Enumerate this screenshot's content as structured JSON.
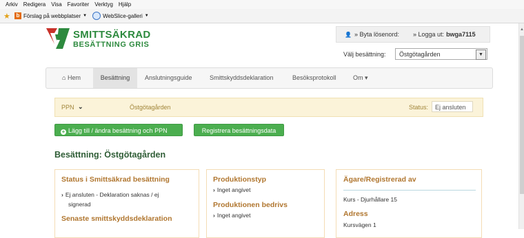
{
  "browser": {
    "menu": [
      "Arkiv",
      "Redigera",
      "Visa",
      "Favoriter",
      "Verktyg",
      "Hjälp"
    ],
    "favorites": [
      {
        "label": "Förslag på webbplatser",
        "icon": "bing-icon"
      },
      {
        "label": "WebSlice-galleri",
        "icon": "ie-icon"
      }
    ]
  },
  "logo": {
    "line1": "SMITTSÄKRAD",
    "line2": "BESÄTTNING GRIS"
  },
  "user": {
    "change_password": "» Byta lösenord:",
    "logout": "» Logga ut:",
    "username": "bwga7115"
  },
  "choose": {
    "label": "Välj besättning:",
    "selected": "Östgötagården"
  },
  "nav": {
    "home": "Hem",
    "items": [
      "Besättning",
      "Anslutningsguide",
      "Smittskyddsdeklaration",
      "Besöksprotokoll",
      "Om ▾"
    ],
    "active": "Besättning"
  },
  "ppn": {
    "label": "PPN",
    "name": "Östgötagården",
    "status_label": "Status:",
    "status": "Ej ansluten"
  },
  "buttons": {
    "add": "Lägg till / ändra besättning och PPN",
    "register": "Registrera besättningsdata"
  },
  "page_title": "Besättning: Östgötagården",
  "panel1": {
    "heading": "Status i Smittsäkrad besättning",
    "status_line1": "Ej ansluten - Deklaration saknas / ej",
    "status_line2": "signerad",
    "heading2": "Senaste smittskyddsdeklaration"
  },
  "panel2": {
    "heading1": "Produktionstyp",
    "value1": "Inget angivet",
    "heading2": "Produktionen bedrivs",
    "value2": "Inget angivet"
  },
  "panel3": {
    "heading": "Ägare/Registrerad av",
    "owner": "Kurs - Djurhållare 15",
    "address_heading": "Adress",
    "address": "Kursvägen 1"
  },
  "colors": {
    "green": "#4bae4f",
    "brand_green": "#2d8a3e",
    "brand_red": "#c8322a",
    "panel_heading": "#b0762f"
  }
}
